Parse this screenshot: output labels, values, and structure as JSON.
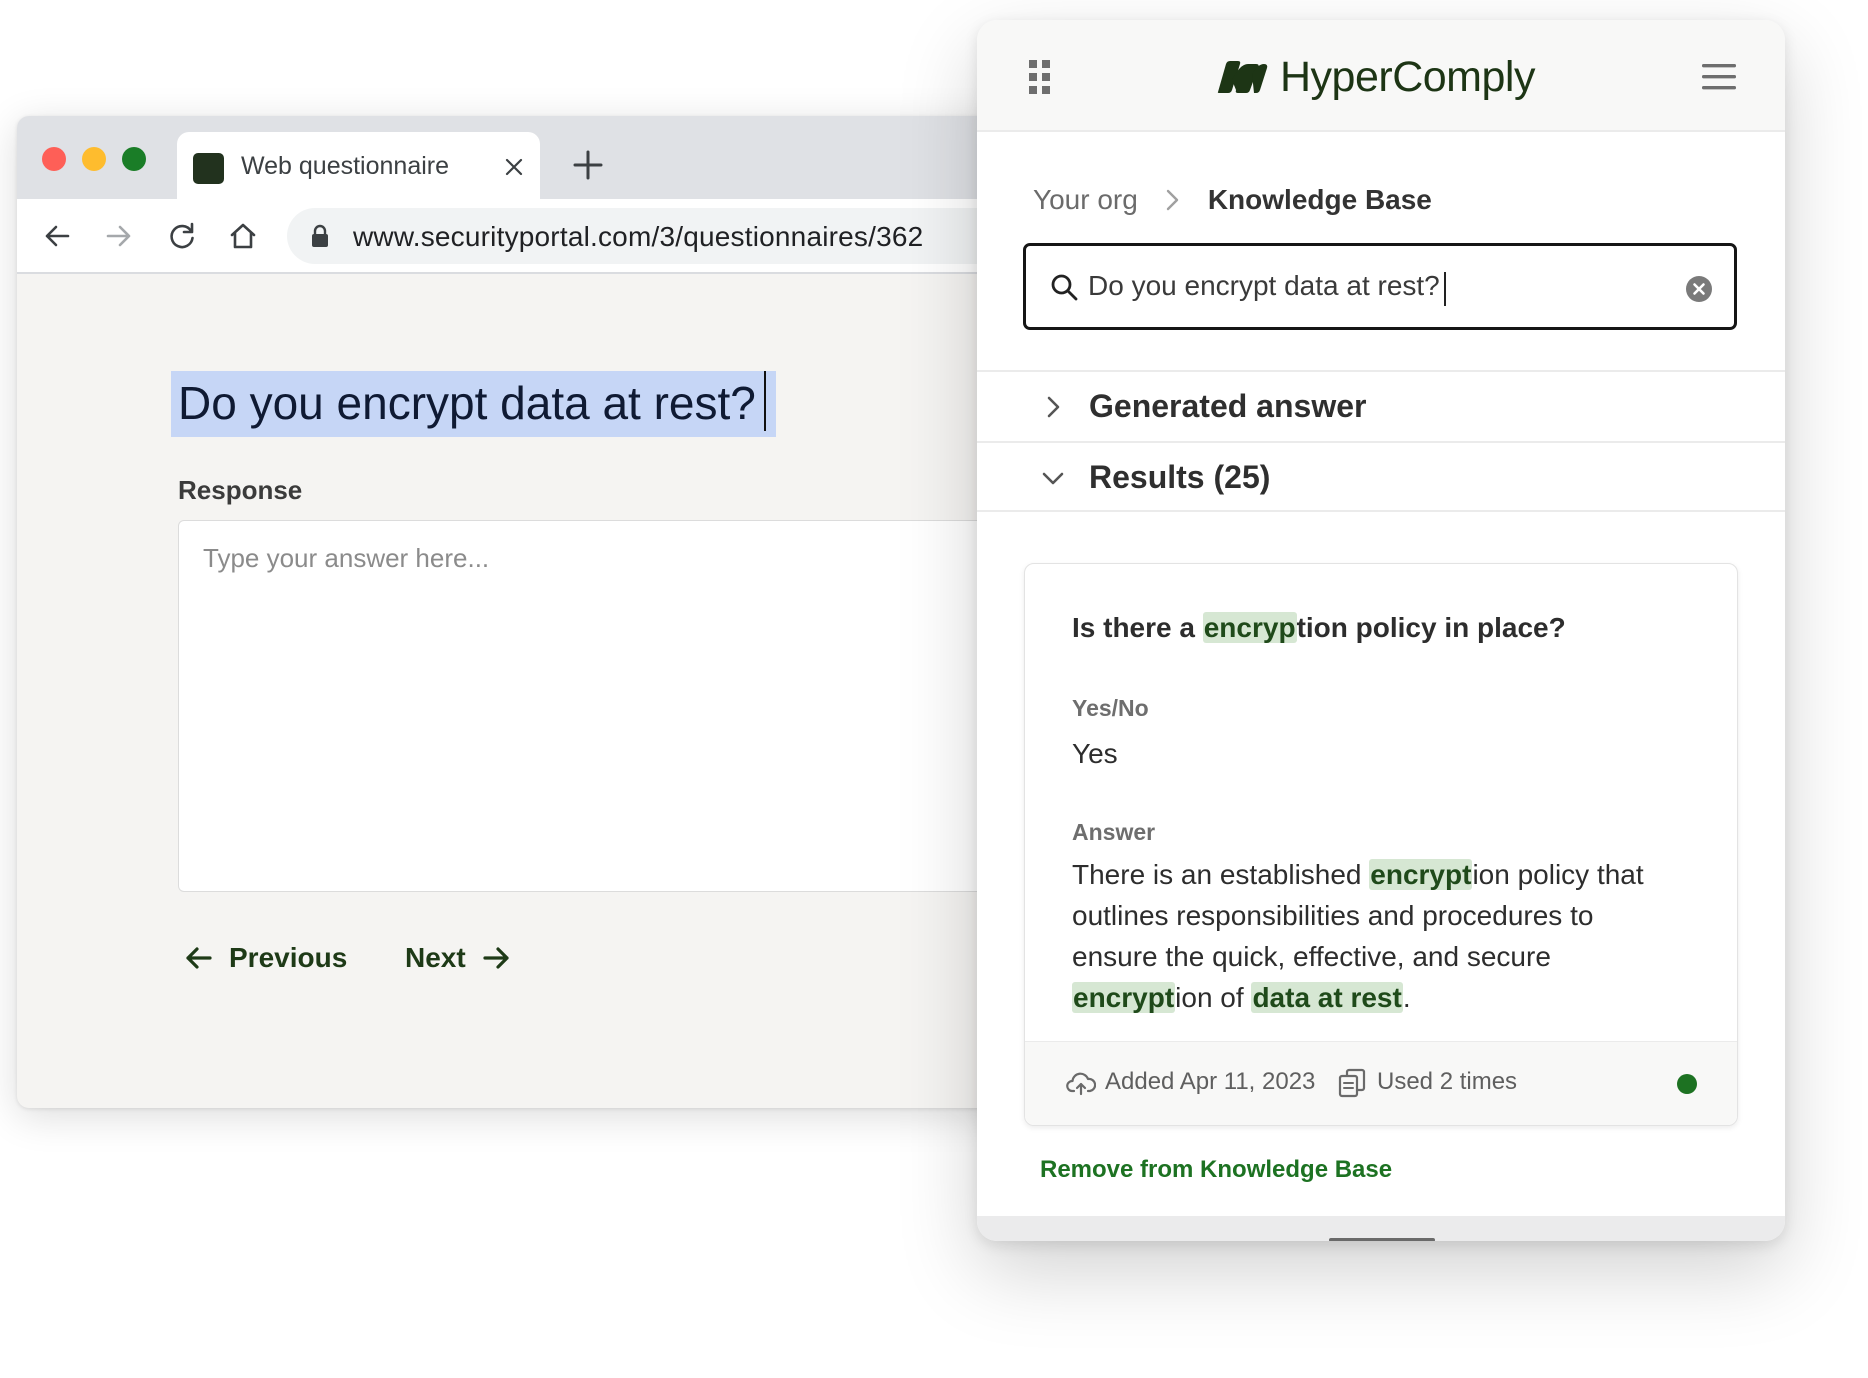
{
  "browser": {
    "tab": {
      "title": "Web questionnaire"
    },
    "url": "www.securityportal.com/3/questionnaires/362",
    "question": "Do you encrypt data at rest?",
    "response_label": "Response",
    "response_placeholder": "Type your answer here...",
    "prev_label": "Previous",
    "next_label": "Next"
  },
  "panel": {
    "brand": "HyperComply",
    "breadcrumb": {
      "org": "Your org",
      "current": "Knowledge Base"
    },
    "search": {
      "value": "Do you encrypt data at rest?"
    },
    "sections": {
      "generated": "Generated answer",
      "results": "Results (25)"
    },
    "card": {
      "question_parts": [
        "Is there a ",
        "encryp",
        "tion policy in place?"
      ],
      "yesno_label": "Yes/No",
      "yesno_value": "Yes",
      "answer_label": "Answer",
      "answer_parts": [
        "There is an established ",
        "encrypt",
        "ion policy that outlines responsibilities and procedures to ensure the quick, effective, and secure ",
        "encrypt",
        "ion of ",
        "data at rest",
        "."
      ],
      "added": "Added Apr 11, 2023",
      "used": "Used 2 times",
      "status_color": "#1d7222"
    },
    "remove_label": "Remove from Knowledge Base"
  },
  "colors": {
    "brand_dark": "#1d3515",
    "accent_green": "#1d7222",
    "highlight": "#d6e7d3",
    "selection": "#c6d6f6"
  },
  "icons": [
    "close-icon",
    "plus-icon",
    "back-arrow-icon",
    "forward-arrow-icon",
    "reload-icon",
    "home-icon",
    "lock-icon",
    "grid-icon",
    "hamburger-menu-icon",
    "search-icon",
    "clear-icon",
    "chevron-right-icon",
    "chevron-down-icon",
    "cloud-upload-icon",
    "copy-icon"
  ]
}
